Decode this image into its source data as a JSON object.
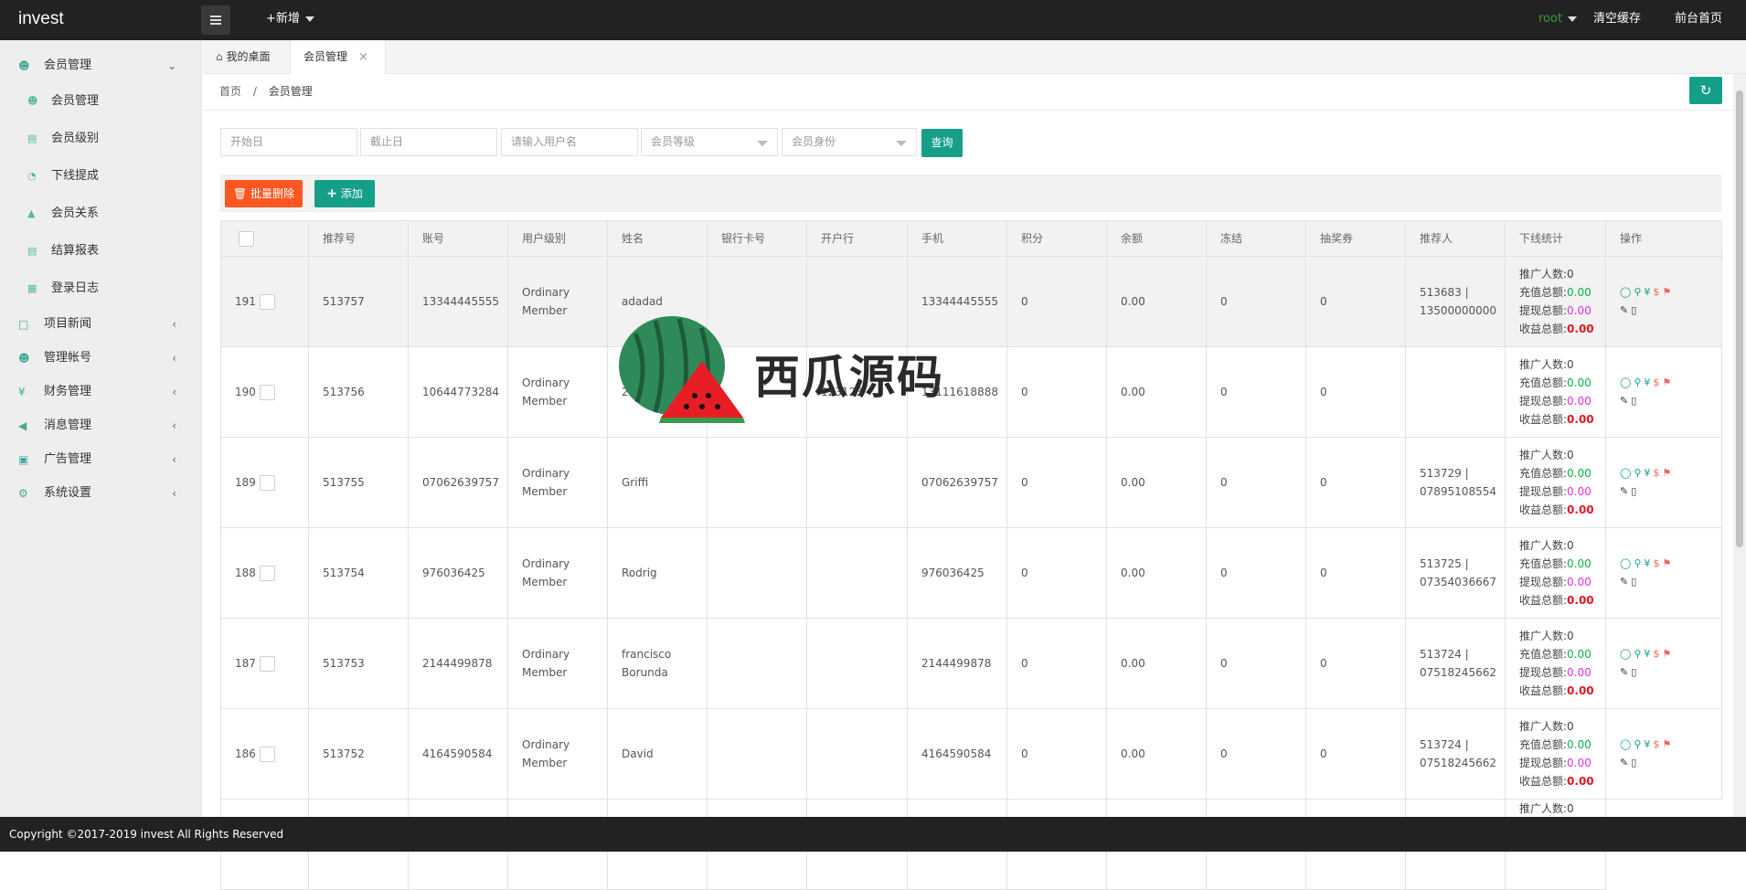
{
  "app": {
    "title": "invest"
  },
  "topbar": {
    "new_label": "+新增",
    "user": "root",
    "clear_cache": "清空缓存",
    "frontend_home": "前台首页"
  },
  "sidebar": {
    "sections": [
      {
        "label": "会员管理",
        "icon": "user-icon",
        "expanded": true,
        "children": [
          {
            "label": "会员管理",
            "icon": "user-icon"
          },
          {
            "label": "会员级别",
            "icon": "list-icon"
          },
          {
            "label": "下线提成",
            "icon": "gauge-icon"
          },
          {
            "label": "会员关系",
            "icon": "tree-icon"
          },
          {
            "label": "结算报表",
            "icon": "list-icon"
          },
          {
            "label": "登录日志",
            "icon": "calendar-icon"
          }
        ]
      },
      {
        "label": "项目新闻",
        "icon": "book-icon"
      },
      {
        "label": "管理帐号",
        "icon": "user-icon"
      },
      {
        "label": "财务管理",
        "icon": "yen-icon"
      },
      {
        "label": "消息管理",
        "icon": "speaker-icon"
      },
      {
        "label": "广告管理",
        "icon": "image-icon"
      },
      {
        "label": "系统设置",
        "icon": "gear-icon"
      }
    ]
  },
  "tabs": [
    {
      "label": "我的桌面",
      "icon": "home-icon"
    },
    {
      "label": "会员管理",
      "active": true
    }
  ],
  "breadcrumb": {
    "home": "首页",
    "sep": "/",
    "current": "会员管理"
  },
  "filters": {
    "start_date": "开始日",
    "end_date": "截止日",
    "username": "请输入用户名",
    "member_level": "会员等级",
    "member_identity": "会员身份",
    "search_label": "查询"
  },
  "toolbar": {
    "batch_delete": "批量删除",
    "add": "添加"
  },
  "table": {
    "headers": [
      "推荐号",
      "账号",
      "用户级别",
      "姓名",
      "银行卡号",
      "开户行",
      "手机",
      "积分",
      "余额",
      "冻结",
      "抽奖券",
      "推荐人",
      "下线统计",
      "操作"
    ],
    "stat_labels": {
      "promoters": "推广人数:",
      "recharge": "充值总额:",
      "withdraw": "提现总额:",
      "income": "收益总额:"
    },
    "rows": [
      {
        "id": "191",
        "ref": "513757",
        "account": "13344445555",
        "level": "Ordinary Member",
        "name": "adadad",
        "bank_card": "",
        "bank": "",
        "phone": "13344445555",
        "points": "0",
        "balance": "0.00",
        "frozen": "0",
        "lottery": "0",
        "referrer": "513683 | 13500000000",
        "promoters": "0",
        "recharge": "0.00",
        "withdraw": "0.00",
        "income": "0.00"
      },
      {
        "id": "190",
        "ref": "513756",
        "account": "10644773284",
        "level": "Ordinary Member",
        "name": "2",
        "bank_card": "",
        "bank": "123123",
        "phone": "13111618888",
        "points": "0",
        "balance": "0.00",
        "frozen": "0",
        "lottery": "0",
        "referrer": "",
        "promoters": "0",
        "recharge": "0.00",
        "withdraw": "0.00",
        "income": "0.00"
      },
      {
        "id": "189",
        "ref": "513755",
        "account": "07062639757",
        "level": "Ordinary Member",
        "name": "Griffi",
        "bank_card": "",
        "bank": "",
        "phone": "07062639757",
        "points": "0",
        "balance": "0.00",
        "frozen": "0",
        "lottery": "0",
        "referrer": "513729 | 07895108554",
        "promoters": "0",
        "recharge": "0.00",
        "withdraw": "0.00",
        "income": "0.00"
      },
      {
        "id": "188",
        "ref": "513754",
        "account": "976036425",
        "level": "Ordinary Member",
        "name": "Rodrig",
        "bank_card": "",
        "bank": "",
        "phone": "976036425",
        "points": "0",
        "balance": "0.00",
        "frozen": "0",
        "lottery": "0",
        "referrer": "513725 | 07354036667",
        "promoters": "0",
        "recharge": "0.00",
        "withdraw": "0.00",
        "income": "0.00"
      },
      {
        "id": "187",
        "ref": "513753",
        "account": "2144499878",
        "level": "Ordinary Member",
        "name": "francisco Borunda",
        "bank_card": "",
        "bank": "",
        "phone": "2144499878",
        "points": "0",
        "balance": "0.00",
        "frozen": "0",
        "lottery": "0",
        "referrer": "513724 | 07518245662",
        "promoters": "0",
        "recharge": "0.00",
        "withdraw": "0.00",
        "income": "0.00"
      },
      {
        "id": "186",
        "ref": "513752",
        "account": "4164590584",
        "level": "Ordinary Member",
        "name": "David",
        "bank_card": "",
        "bank": "",
        "phone": "4164590584",
        "points": "0",
        "balance": "0.00",
        "frozen": "0",
        "lottery": "0",
        "referrer": "513724 | 07518245662",
        "promoters": "0",
        "recharge": "0.00",
        "withdraw": "0.00",
        "income": "0.00"
      }
    ],
    "partial_row_label": "推广人数:0"
  },
  "watermark": {
    "text": "西瓜源码"
  },
  "footer": {
    "text": "Copyright ©2017-2019 invest All Rights Reserved"
  },
  "colors": {
    "accent": "#159f88",
    "danger": "#ff5722",
    "topbar": "#222222",
    "sidebar": "#eeeeee"
  }
}
